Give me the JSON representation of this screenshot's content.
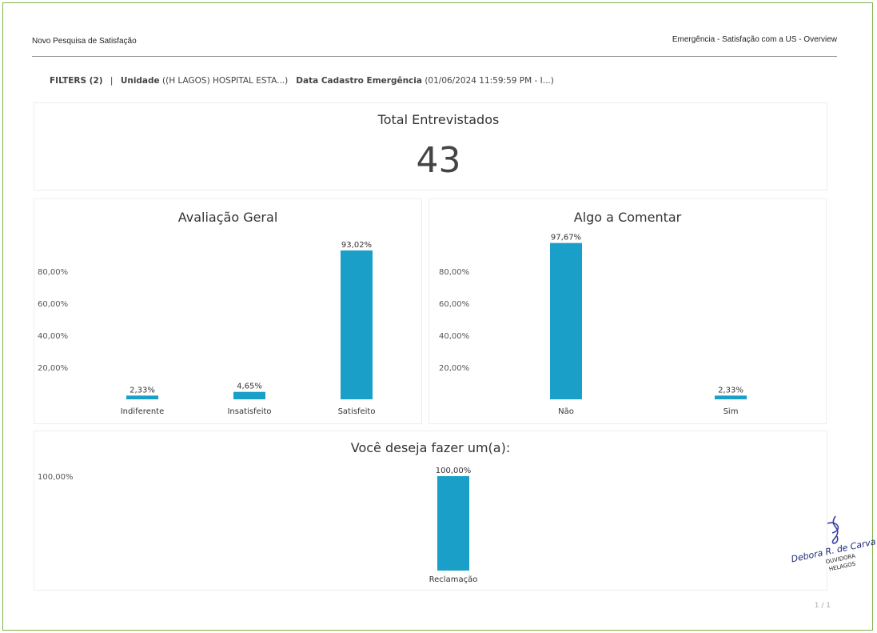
{
  "header": {
    "left_title": "Novo Pesquisa de Satisfação",
    "right_title": "Emergência - Satisfação com a US - Overview"
  },
  "filters": {
    "label": "FILTERS (2)",
    "separator": "|",
    "unidade_label": "Unidade",
    "unidade_value": "((H LAGOS) HOSPITAL ESTA...)",
    "data_label": "Data Cadastro Emergência",
    "data_value": "(01/06/2024 11:59:59 PM - I...)"
  },
  "kpi": {
    "title": "Total Entrevistados",
    "value": "43"
  },
  "page": {
    "number": "1 / 1"
  },
  "signature": {
    "name": "Debora R. de Carvalho",
    "role": "OUVIDORA",
    "org": "HELAGOS"
  },
  "colors": {
    "bar": "#1a9fc9",
    "frame": "#7fb24a"
  },
  "chart_data": [
    {
      "type": "bar",
      "title": "Avaliação Geral",
      "categories": [
        "Indiferente",
        "Insatisfeito",
        "Satisfeito"
      ],
      "values": [
        2.33,
        4.65,
        93.02
      ],
      "value_labels": [
        "2,33%",
        "4,65%",
        "93,02%"
      ],
      "y_ticks": [
        20,
        40,
        60,
        80
      ],
      "y_tick_labels": [
        "20,00%",
        "40,00%",
        "60,00%",
        "80,00%"
      ],
      "ylim": [
        0,
        100
      ],
      "grid": false
    },
    {
      "type": "bar",
      "title": "Algo a Comentar",
      "categories": [
        "Não",
        "Sim"
      ],
      "values": [
        97.67,
        2.33
      ],
      "value_labels": [
        "97,67%",
        "2,33%"
      ],
      "y_ticks": [
        20,
        40,
        60,
        80
      ],
      "y_tick_labels": [
        "20,00%",
        "40,00%",
        "60,00%",
        "80,00%"
      ],
      "ylim": [
        0,
        100
      ],
      "grid": false
    },
    {
      "type": "bar",
      "title": "Você deseja fazer um(a):",
      "categories": [
        "Reclamação"
      ],
      "values": [
        100
      ],
      "value_labels": [
        "100,00%"
      ],
      "y_ticks": [
        100
      ],
      "y_tick_labels": [
        "100,00%"
      ],
      "ylim": [
        0,
        100
      ],
      "grid": false
    }
  ]
}
